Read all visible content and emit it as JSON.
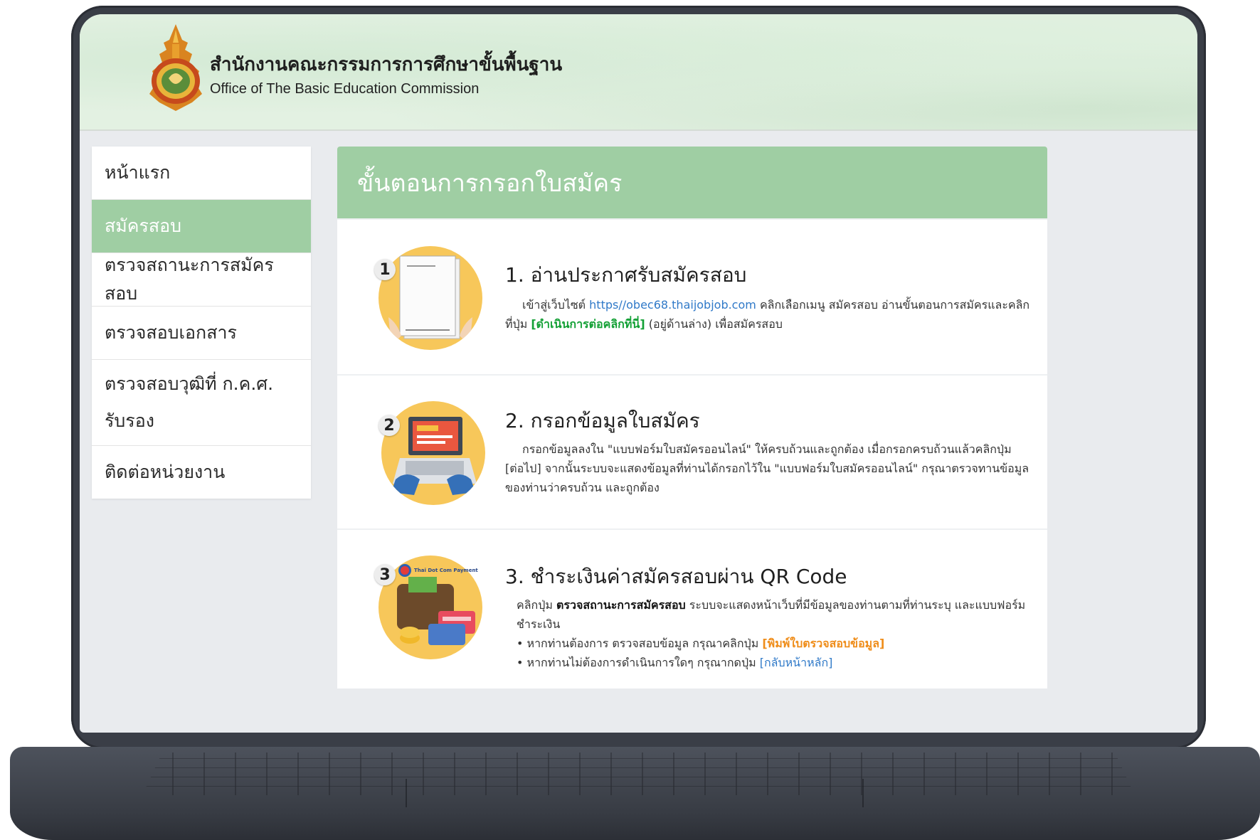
{
  "header": {
    "org_name_th": "สำนักงานคณะกรรมการการศึกษาขั้นพื้นฐาน",
    "org_name_en": "Office of The Basic Education Commission"
  },
  "sidebar": {
    "items": [
      {
        "label": "หน้าแรก",
        "active": false
      },
      {
        "label": "สมัครสอบ",
        "active": true
      },
      {
        "label": "ตรวจสถานะการสมัครสอบ",
        "active": false
      },
      {
        "label": "ตรวจสอบเอกสาร",
        "active": false
      },
      {
        "label": "ตรวจสอบวุฒิที่ ก.ค.ศ.",
        "label2": "รับรอง",
        "active": false
      },
      {
        "label": "ติดต่อหน่วยงาน",
        "active": false
      }
    ]
  },
  "main": {
    "title": "ขั้นตอนการกรอกใบสมัคร",
    "steps": [
      {
        "number": "1",
        "title": "1.  อ่านประกาศรับสมัครสอบ",
        "text_a": "เข้าสู่เว็บไซต์ ",
        "link_url": "https//obec68.thaijobjob.com",
        "text_b": " คลิกเลือกเมนู สมัครสอบ อ่านขั้นตอนการสมัครและคลิกที่ปุ่ม ",
        "button_label": "[ดำเนินการต่อคลิกที่นี่]",
        "text_c": " (อยู่ด้านล่าง) เพื่อสมัครสอบ"
      },
      {
        "number": "2",
        "title": "2.  กรอกข้อมูลใบสมัคร",
        "text": "กรอกข้อมูลลงใน \"แบบฟอร์มใบสมัครออนไลน์\" ให้ครบถ้วนและถูกต้อง เมื่อกรอกครบถ้วนแล้วคลิกปุ่ม [ต่อไป] จากนั้นระบบจะแสดงข้อมูลที่ท่านได้กรอกไว้ใน \"แบบฟอร์มใบสมัครออนไลน์\" กรุณาตรวจทานข้อมูลของท่านว่าครบถ้วน และถูกต้อง"
      },
      {
        "number": "3",
        "title": "3.  ชำระเงินค่าสมัครสอบผ่าน QR Code",
        "text_a": "คลิกปุ่ม ",
        "text_bold": "ตรวจสถานะการสมัครสอบ",
        "text_b": " ระบบจะแสดงหน้าเว็บที่มีข้อมูลของท่านตามที่ท่านระบุ และแบบฟอร์มชำระเงิน",
        "bullet1_text": "• หากท่านต้องการ ตรวจสอบข้อมูล กรุณาคลิกปุ่ม ",
        "bullet1_link": "[พิมพ์ใบตรวจสอบข้อมูล]",
        "bullet2_text": "• หากท่านไม่ต้องการดำเนินการใดๆ กรุณากดปุ่ม ",
        "bullet2_link": "[กลับหน้าหลัก]",
        "payment_badge": "Thai Dot Com Payment"
      }
    ]
  },
  "colors": {
    "accent_green": "#9fcea3",
    "illustration_yellow": "#f7c75a",
    "link_blue": "#2f79c8",
    "button_green": "#13a035",
    "link_orange": "#ef8d1a"
  }
}
